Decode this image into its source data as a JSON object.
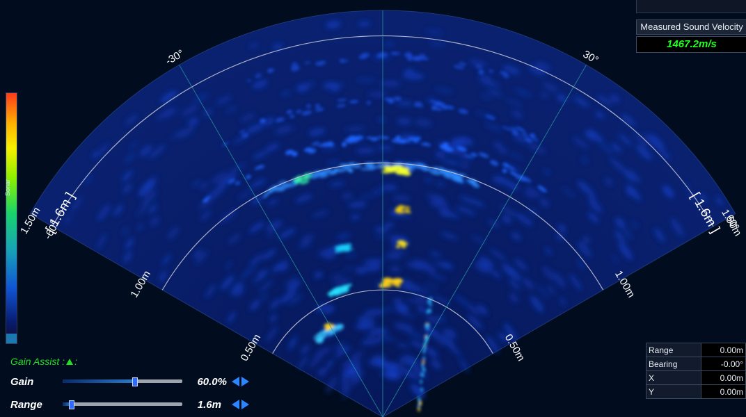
{
  "sonar": {
    "scale_label": "Sonar",
    "angle_labels": [
      "-60°",
      "-30°",
      "30°",
      "60°"
    ],
    "range_bracket_labels": [
      "[ 1.6m ]",
      "[ 1.6m ]"
    ],
    "range_ring_labels": [
      "0.50m",
      "1.00m",
      "1.50m"
    ]
  },
  "sound_velocity": {
    "title": "Measured Sound Velocity",
    "value": "1467.2m/s"
  },
  "readout": {
    "rows": [
      {
        "label": "Range",
        "value": "0.00m"
      },
      {
        "label": "Bearing",
        "value": "-0.00°"
      },
      {
        "label": "X",
        "value": "0.00m"
      },
      {
        "label": "Y",
        "value": "0.00m"
      }
    ]
  },
  "controls": {
    "gain_assist_label": "Gain Assist :",
    "gain": {
      "label": "Gain",
      "value_text": "60.0%",
      "fraction": 0.6
    },
    "range": {
      "label": "Range",
      "value_text": "1.6m",
      "fraction": 0.07
    }
  },
  "colors": {
    "background": "#020c1f",
    "accent_green": "#22ff22",
    "arrow_blue": "#2b86ff",
    "ring": "#c8c8d8",
    "bearing_line": "#2aa0a6"
  }
}
